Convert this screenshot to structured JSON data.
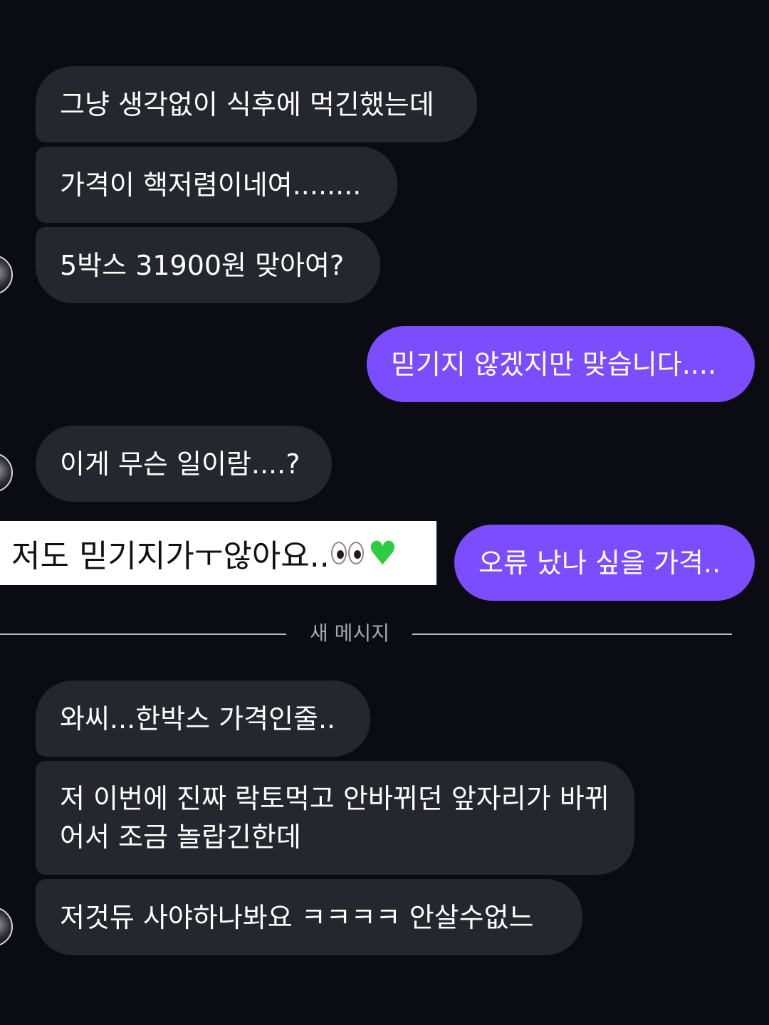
{
  "messages": {
    "m1": "그냥 생각없이 식후에 먹긴했는데",
    "m2": "가격이 핵저렴이네여........",
    "m3": "5박스 31900원 맞아여?",
    "m4": "믿기지 않겠지만 맞습니다....",
    "m5": "이게 무슨 일이람....?",
    "m6": "오류 났나 싶을 가격..",
    "m7": "와씨...한박스 가격인줄..",
    "m8": "저 이번에 진짜 락토먹고 안바뀌던 앞자리가 바뀌어서 조금 놀랍긴한데",
    "m9": "저것듀 사야하나봐요 ㅋㅋㅋㅋ 안살수없느"
  },
  "caption": {
    "text": "저도 믿기지가ㅜ않아요..",
    "emoji": [
      "eyes-emoji",
      "green-heart-emoji"
    ]
  },
  "divider": {
    "label": "새 메시지"
  },
  "colors": {
    "background": "#0b0b14",
    "incoming_bubble": "#26272e",
    "outgoing_bubble": "#7c4dff",
    "divider": "#b9bac2"
  }
}
